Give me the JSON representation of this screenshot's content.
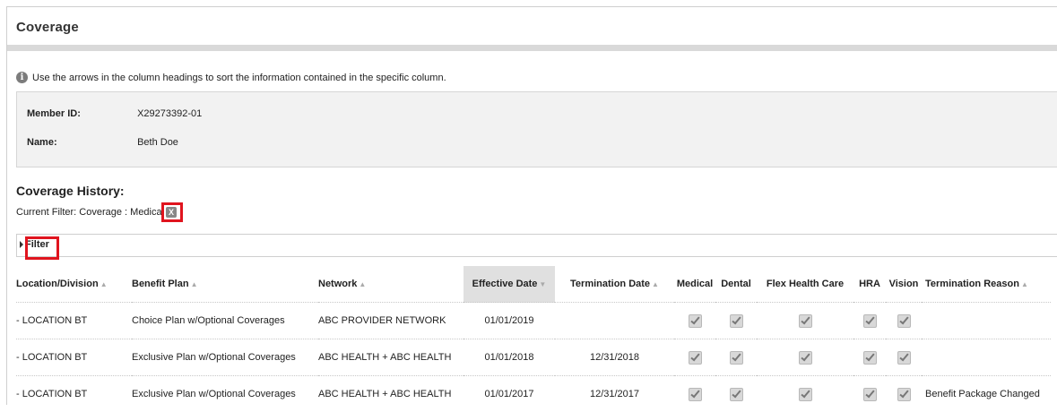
{
  "page": {
    "title": "Coverage"
  },
  "info": {
    "text": "Use the arrows in the column headings to sort the information contained in the specific column."
  },
  "member": {
    "id_label": "Member ID:",
    "id_value": "X29273392-01",
    "name_label": "Name:",
    "name_value": "Beth Doe"
  },
  "history": {
    "title": "Coverage History:",
    "current_filter": "Current Filter: Coverage : Medical",
    "clear_filter_label": "X",
    "filter_toggle": "Filter"
  },
  "table": {
    "columns": [
      {
        "label": "Location/Division",
        "sortable": true
      },
      {
        "label": "Benefit Plan",
        "sortable": true
      },
      {
        "label": "Network",
        "sortable": true
      },
      {
        "label": "Effective Date",
        "sortable": true,
        "sorted": true
      },
      {
        "label": "Termination Date",
        "sortable": true
      },
      {
        "label": "Medical",
        "sortable": false
      },
      {
        "label": "Dental",
        "sortable": false
      },
      {
        "label": "Flex Health Care",
        "sortable": false
      },
      {
        "label": "HRA",
        "sortable": false
      },
      {
        "label": "Vision",
        "sortable": false
      },
      {
        "label": "Termination Reason",
        "sortable": true
      }
    ],
    "rows": [
      {
        "location": "- LOCATION BT",
        "plan": "Choice Plan w/Optional Coverages",
        "network": "ABC PROVIDER NETWORK",
        "effective": "01/01/2019",
        "termination": "",
        "medical": true,
        "dental": true,
        "flex": true,
        "hra": true,
        "vision": true,
        "reason": ""
      },
      {
        "location": "- LOCATION BT",
        "plan": "Exclusive Plan w/Optional Coverages",
        "network": "ABC HEALTH + ABC HEALTH",
        "effective": "01/01/2018",
        "termination": "12/31/2018",
        "medical": true,
        "dental": true,
        "flex": true,
        "hra": true,
        "vision": true,
        "reason": ""
      },
      {
        "location": "- LOCATION BT",
        "plan": "Exclusive Plan w/Optional Coverages",
        "network": "ABC HEALTH + ABC HEALTH",
        "effective": "01/01/2017",
        "termination": "12/31/2017",
        "medical": true,
        "dental": true,
        "flex": true,
        "hra": true,
        "vision": true,
        "reason": "Benefit Package Changed"
      }
    ]
  },
  "colors": {
    "highlight": "#e0141e",
    "sorted_header": "#e0e0e0",
    "panel": "#f2f2f2"
  },
  "icons": {
    "info": "info-icon",
    "checkbox": "checkmark-icon",
    "caret": "caret-right-icon"
  }
}
